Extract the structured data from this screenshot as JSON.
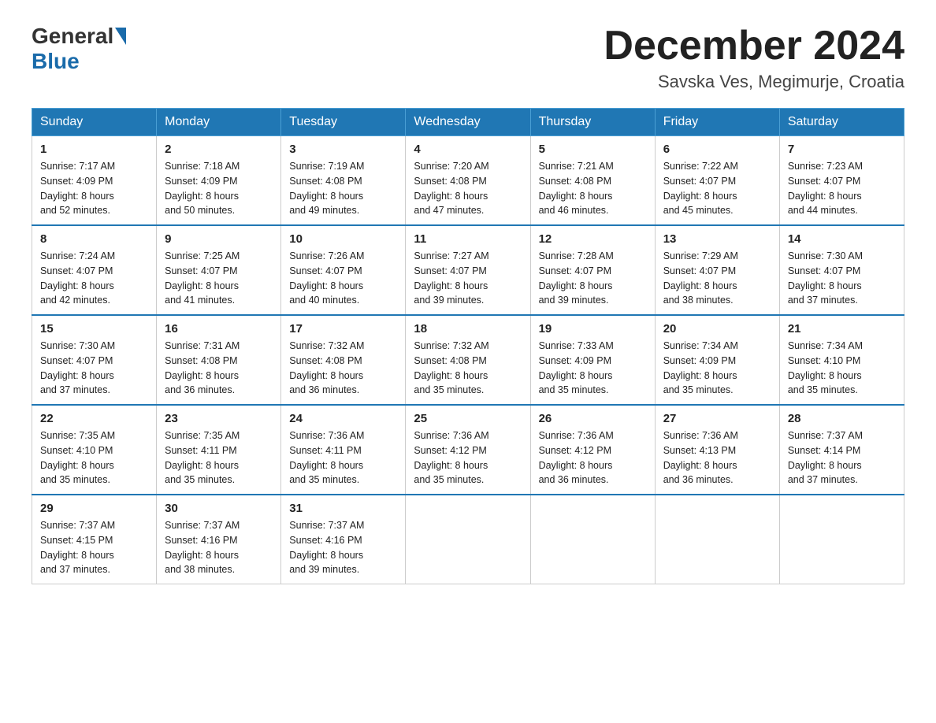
{
  "header": {
    "logo_general": "General",
    "logo_blue": "Blue",
    "month_title": "December 2024",
    "location": "Savska Ves, Megimurje, Croatia"
  },
  "days_of_week": [
    "Sunday",
    "Monday",
    "Tuesday",
    "Wednesday",
    "Thursday",
    "Friday",
    "Saturday"
  ],
  "weeks": [
    [
      {
        "day": "1",
        "sunrise": "7:17 AM",
        "sunset": "4:09 PM",
        "daylight": "8 hours and 52 minutes."
      },
      {
        "day": "2",
        "sunrise": "7:18 AM",
        "sunset": "4:09 PM",
        "daylight": "8 hours and 50 minutes."
      },
      {
        "day": "3",
        "sunrise": "7:19 AM",
        "sunset": "4:08 PM",
        "daylight": "8 hours and 49 minutes."
      },
      {
        "day": "4",
        "sunrise": "7:20 AM",
        "sunset": "4:08 PM",
        "daylight": "8 hours and 47 minutes."
      },
      {
        "day": "5",
        "sunrise": "7:21 AM",
        "sunset": "4:08 PM",
        "daylight": "8 hours and 46 minutes."
      },
      {
        "day": "6",
        "sunrise": "7:22 AM",
        "sunset": "4:07 PM",
        "daylight": "8 hours and 45 minutes."
      },
      {
        "day": "7",
        "sunrise": "7:23 AM",
        "sunset": "4:07 PM",
        "daylight": "8 hours and 44 minutes."
      }
    ],
    [
      {
        "day": "8",
        "sunrise": "7:24 AM",
        "sunset": "4:07 PM",
        "daylight": "8 hours and 42 minutes."
      },
      {
        "day": "9",
        "sunrise": "7:25 AM",
        "sunset": "4:07 PM",
        "daylight": "8 hours and 41 minutes."
      },
      {
        "day": "10",
        "sunrise": "7:26 AM",
        "sunset": "4:07 PM",
        "daylight": "8 hours and 40 minutes."
      },
      {
        "day": "11",
        "sunrise": "7:27 AM",
        "sunset": "4:07 PM",
        "daylight": "8 hours and 39 minutes."
      },
      {
        "day": "12",
        "sunrise": "7:28 AM",
        "sunset": "4:07 PM",
        "daylight": "8 hours and 39 minutes."
      },
      {
        "day": "13",
        "sunrise": "7:29 AM",
        "sunset": "4:07 PM",
        "daylight": "8 hours and 38 minutes."
      },
      {
        "day": "14",
        "sunrise": "7:30 AM",
        "sunset": "4:07 PM",
        "daylight": "8 hours and 37 minutes."
      }
    ],
    [
      {
        "day": "15",
        "sunrise": "7:30 AM",
        "sunset": "4:07 PM",
        "daylight": "8 hours and 37 minutes."
      },
      {
        "day": "16",
        "sunrise": "7:31 AM",
        "sunset": "4:08 PM",
        "daylight": "8 hours and 36 minutes."
      },
      {
        "day": "17",
        "sunrise": "7:32 AM",
        "sunset": "4:08 PM",
        "daylight": "8 hours and 36 minutes."
      },
      {
        "day": "18",
        "sunrise": "7:32 AM",
        "sunset": "4:08 PM",
        "daylight": "8 hours and 35 minutes."
      },
      {
        "day": "19",
        "sunrise": "7:33 AM",
        "sunset": "4:09 PM",
        "daylight": "8 hours and 35 minutes."
      },
      {
        "day": "20",
        "sunrise": "7:34 AM",
        "sunset": "4:09 PM",
        "daylight": "8 hours and 35 minutes."
      },
      {
        "day": "21",
        "sunrise": "7:34 AM",
        "sunset": "4:10 PM",
        "daylight": "8 hours and 35 minutes."
      }
    ],
    [
      {
        "day": "22",
        "sunrise": "7:35 AM",
        "sunset": "4:10 PM",
        "daylight": "8 hours and 35 minutes."
      },
      {
        "day": "23",
        "sunrise": "7:35 AM",
        "sunset": "4:11 PM",
        "daylight": "8 hours and 35 minutes."
      },
      {
        "day": "24",
        "sunrise": "7:36 AM",
        "sunset": "4:11 PM",
        "daylight": "8 hours and 35 minutes."
      },
      {
        "day": "25",
        "sunrise": "7:36 AM",
        "sunset": "4:12 PM",
        "daylight": "8 hours and 35 minutes."
      },
      {
        "day": "26",
        "sunrise": "7:36 AM",
        "sunset": "4:12 PM",
        "daylight": "8 hours and 36 minutes."
      },
      {
        "day": "27",
        "sunrise": "7:36 AM",
        "sunset": "4:13 PM",
        "daylight": "8 hours and 36 minutes."
      },
      {
        "day": "28",
        "sunrise": "7:37 AM",
        "sunset": "4:14 PM",
        "daylight": "8 hours and 37 minutes."
      }
    ],
    [
      {
        "day": "29",
        "sunrise": "7:37 AM",
        "sunset": "4:15 PM",
        "daylight": "8 hours and 37 minutes."
      },
      {
        "day": "30",
        "sunrise": "7:37 AM",
        "sunset": "4:16 PM",
        "daylight": "8 hours and 38 minutes."
      },
      {
        "day": "31",
        "sunrise": "7:37 AM",
        "sunset": "4:16 PM",
        "daylight": "8 hours and 39 minutes."
      },
      null,
      null,
      null,
      null
    ]
  ],
  "labels": {
    "sunrise": "Sunrise:",
    "sunset": "Sunset:",
    "daylight": "Daylight:"
  }
}
